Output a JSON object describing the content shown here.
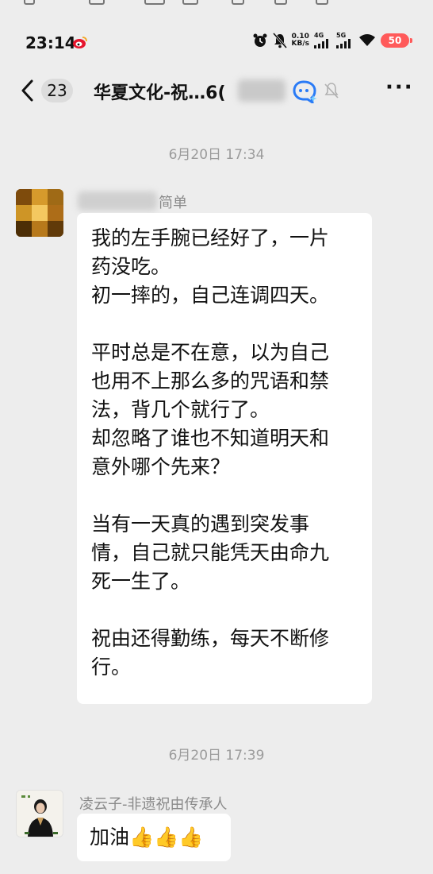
{
  "status_bar": {
    "time": "23:14",
    "net_speed_value": "0.10",
    "net_speed_unit": "KB/s",
    "signal_1_type": "4G",
    "signal_2_type": "5G",
    "battery_level": "50"
  },
  "navbar": {
    "unread_count": "23",
    "title": "华夏文化-祝…6("
  },
  "messages": [
    {
      "timestamp": "6月20日 17:34",
      "sender_name_visible": "简单",
      "text": "我的左手腕已经好了，一片\n药没吃。\n初一摔的，自己连调四天。\n\n平时总是不在意，以为自己\n也用不上那么多的咒语和禁\n法，背几个就行了。\n却忽略了谁也不知道明天和\n意外哪个先来？\n\n当有一天真的遇到突发事\n情，自己就只能凭天由命九\n死一生了。\n\n祝由还得勤练，每天不断修\n行。"
    },
    {
      "timestamp": "6月20日 17:39",
      "sender_name": "凌云子-非遗祝由传承人",
      "text": "加油👍👍👍"
    }
  ],
  "colors": {
    "background": "#ededed",
    "bubble": "#ffffff",
    "battery": "#ff5a5a",
    "timestamp_text": "#9b9b9b"
  },
  "icons": [
    "weibo-icon",
    "alarm-icon",
    "mute-bell-icon",
    "wifi-icon",
    "back-chevron-icon",
    "ai-assistant-icon",
    "muted-notification-icon",
    "more-icon"
  ]
}
